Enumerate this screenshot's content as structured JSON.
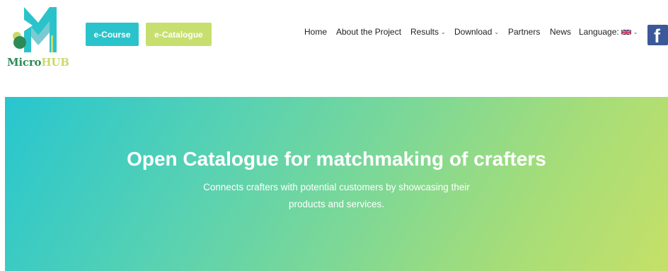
{
  "logo": {
    "part1": "Micro",
    "part2": "HUB"
  },
  "buttons": {
    "course": "e-Course",
    "catalogue": "e-Catalogue"
  },
  "nav": {
    "home": "Home",
    "about": "About the Project",
    "results": "Results",
    "download": "Download",
    "partners": "Partners",
    "news": "News",
    "language": "Language:"
  },
  "icons": {
    "chevron": "chevron-down-icon",
    "flag": "uk-flag-icon",
    "facebook": "facebook-icon",
    "facebook_glyph": "f"
  },
  "hero": {
    "title": "Open Catalogue for matchmaking of crafters",
    "subtitle_line1": "Connects crafters with potential customers by showcasing their",
    "subtitle_line2": "products and services."
  },
  "colors": {
    "teal": "#2bc3cb",
    "lime": "#c7df6e",
    "facebook": "#3b5998",
    "logo_green": "#2d8a56"
  }
}
